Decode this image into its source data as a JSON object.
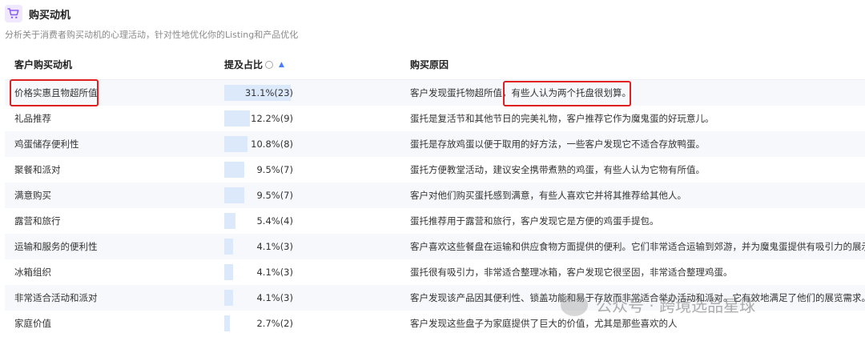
{
  "header": {
    "title": "购买动机",
    "subtitle": "分析关于消费者购买动机的心理活动，针对性地优化你的Listing和产品优化"
  },
  "columns": {
    "motive": "客户购买动机",
    "ratio": "提及占比",
    "reason": "购买原因"
  },
  "rows": [
    {
      "motive": "价格实惠且物超所值",
      "ratio": "31.1%(23)",
      "fraction": 0.311,
      "reason_a": "客户发现蛋托物超所值，",
      "reason_b": "有些人认为两个托盘很划算。"
    },
    {
      "motive": "礼品推荐",
      "ratio": "12.2%(9)",
      "fraction": 0.122,
      "reason_a": "蛋托是复活节和其他节日的完美礼物，客户推荐它作为魔鬼蛋的好玩意儿。",
      "reason_b": ""
    },
    {
      "motive": "鸡蛋储存便利性",
      "ratio": "10.8%(8)",
      "fraction": 0.108,
      "reason_a": "蛋托是存放鸡蛋以便于取用的好方法，一些客户发现它不适合存放鸭蛋。",
      "reason_b": ""
    },
    {
      "motive": "聚餐和派对",
      "ratio": "9.5%(7)",
      "fraction": 0.095,
      "reason_a": "蛋托方便教堂活动，建议安全携带煮熟的鸡蛋，有些人认为它物有所值。",
      "reason_b": ""
    },
    {
      "motive": "满意购买",
      "ratio": "9.5%(7)",
      "fraction": 0.095,
      "reason_a": "客户对他们购买蛋托感到满意，有些人喜欢它并将其推荐给其他人。",
      "reason_b": ""
    },
    {
      "motive": "露营和旅行",
      "ratio": "5.4%(4)",
      "fraction": 0.054,
      "reason_a": "蛋托推荐用于露营和旅行，客户发现它是方便的鸡蛋手提包。",
      "reason_b": ""
    },
    {
      "motive": "运输和服务的便利性",
      "ratio": "4.1%(3)",
      "fraction": 0.041,
      "reason_a": "客户喜欢这些餐盘在运输和供应食物方面提供的便利。它们非常适合运输到郊游，并为魔鬼蛋提供有吸引力的展示。",
      "reason_b": ""
    },
    {
      "motive": "冰箱组织",
      "ratio": "4.1%(3)",
      "fraction": 0.041,
      "reason_a": "蛋托很有吸引力，非常适合整理冰箱，客户发现它很坚固，非常适合整理鸡蛋。",
      "reason_b": ""
    },
    {
      "motive": "非常适合活动和派对",
      "ratio": "4.1%(3)",
      "fraction": 0.041,
      "reason_a": "客户发现该产品因其便利性、锁盖功能和易于存放而非常适合举办活动和派对。它有效地满足了他们的展览需求。",
      "reason_b": ""
    },
    {
      "motive": "家庭价值",
      "ratio": "2.7%(2)",
      "fraction": 0.027,
      "reason_a": "客户发现这些盘子为家庭提供了巨大的价值，尤其是那些喜欢的人",
      "reason_b": ""
    }
  ],
  "watermark": "公众号 · 跨境选品星球",
  "colors": {
    "bar": "#dce9fb",
    "highlight": "#e02020",
    "accent": "#4a7bff",
    "icon": "#8a5cf5"
  },
  "icons": {
    "header": "shopping-cart-icon",
    "info": "info-icon",
    "sort": "sort-icon"
  }
}
